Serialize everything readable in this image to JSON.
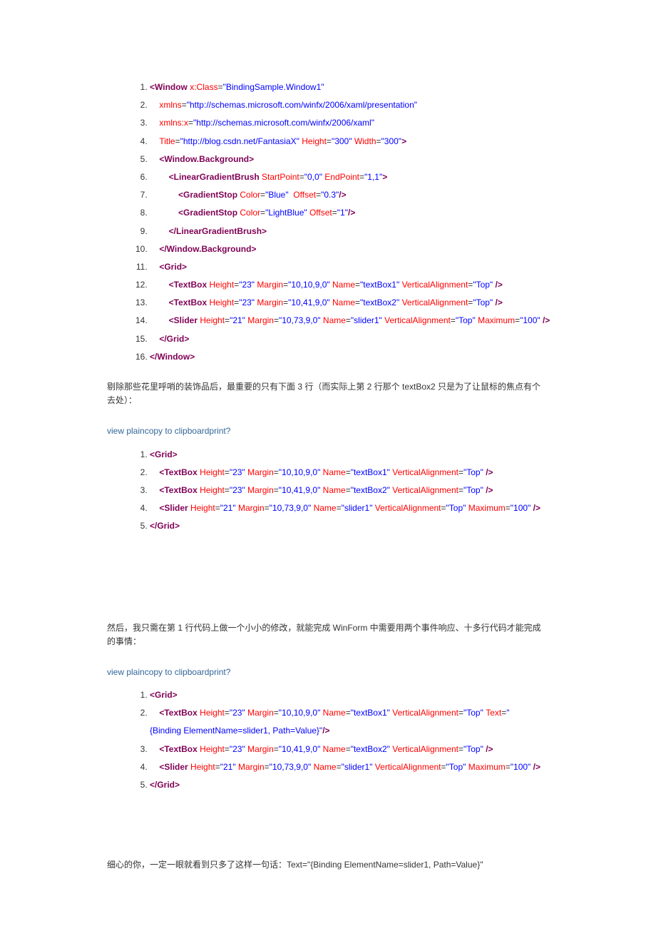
{
  "block1": {
    "lines": [
      [
        {
          "c": "tag",
          "t": "<Window"
        },
        {
          "c": "attr",
          "t": " x:Class"
        },
        {
          "c": "",
          "t": "="
        },
        {
          "c": "val",
          "t": "\"BindingSample.Window1\""
        }
      ],
      [
        {
          "c": "",
          "t": "    "
        },
        {
          "c": "attr",
          "t": "xmlns"
        },
        {
          "c": "",
          "t": "="
        },
        {
          "c": "val",
          "t": "\"http://schemas.microsoft.com/winfx/2006/xaml/presentation\""
        }
      ],
      [
        {
          "c": "",
          "t": "    "
        },
        {
          "c": "attr",
          "t": "xmlns:x"
        },
        {
          "c": "",
          "t": "="
        },
        {
          "c": "val",
          "t": "\"http://schemas.microsoft.com/winfx/2006/xaml\""
        }
      ],
      [
        {
          "c": "",
          "t": "    "
        },
        {
          "c": "attr",
          "t": "Title"
        },
        {
          "c": "",
          "t": "="
        },
        {
          "c": "val",
          "t": "\"http://blog.csdn.net/FantasiaX\""
        },
        {
          "c": "attr",
          "t": " Height"
        },
        {
          "c": "",
          "t": "="
        },
        {
          "c": "val",
          "t": "\"300\""
        },
        {
          "c": "attr",
          "t": " Width"
        },
        {
          "c": "",
          "t": "="
        },
        {
          "c": "val",
          "t": "\"300\""
        },
        {
          "c": "tag",
          "t": ">"
        }
      ],
      [
        {
          "c": "",
          "t": "    "
        },
        {
          "c": "tag",
          "t": "<Window.Background>"
        }
      ],
      [
        {
          "c": "",
          "t": "        "
        },
        {
          "c": "tag",
          "t": "<LinearGradientBrush"
        },
        {
          "c": "attr",
          "t": " StartPoint"
        },
        {
          "c": "",
          "t": "="
        },
        {
          "c": "val",
          "t": "\"0,0\""
        },
        {
          "c": "attr",
          "t": " EndPoint"
        },
        {
          "c": "",
          "t": "="
        },
        {
          "c": "val",
          "t": "\"1,1\""
        },
        {
          "c": "tag",
          "t": ">"
        }
      ],
      [
        {
          "c": "",
          "t": "            "
        },
        {
          "c": "tag",
          "t": "<GradientStop"
        },
        {
          "c": "attr",
          "t": " Color"
        },
        {
          "c": "",
          "t": "="
        },
        {
          "c": "val",
          "t": "\"Blue\""
        },
        {
          "c": "attr",
          "t": "  Offset"
        },
        {
          "c": "",
          "t": "="
        },
        {
          "c": "val",
          "t": "\"0.3\""
        },
        {
          "c": "tag",
          "t": "/>"
        }
      ],
      [
        {
          "c": "",
          "t": "            "
        },
        {
          "c": "tag",
          "t": "<GradientStop"
        },
        {
          "c": "attr",
          "t": " Color"
        },
        {
          "c": "",
          "t": "="
        },
        {
          "c": "val",
          "t": "\"LightBlue\""
        },
        {
          "c": "attr",
          "t": " Offset"
        },
        {
          "c": "",
          "t": "="
        },
        {
          "c": "val",
          "t": "\"1\""
        },
        {
          "c": "tag",
          "t": "/>"
        }
      ],
      [
        {
          "c": "",
          "t": "        "
        },
        {
          "c": "tag",
          "t": "</LinearGradientBrush>"
        }
      ],
      [
        {
          "c": "",
          "t": "    "
        },
        {
          "c": "tag",
          "t": "</Window.Background>"
        }
      ],
      [
        {
          "c": "",
          "t": "    "
        },
        {
          "c": "tag",
          "t": "<Grid>"
        }
      ],
      [
        {
          "c": "",
          "t": "        "
        },
        {
          "c": "tag",
          "t": "<TextBox"
        },
        {
          "c": "attr",
          "t": " Height"
        },
        {
          "c": "",
          "t": "="
        },
        {
          "c": "val",
          "t": "\"23\""
        },
        {
          "c": "attr",
          "t": " Margin"
        },
        {
          "c": "",
          "t": "="
        },
        {
          "c": "val",
          "t": "\"10,10,9,0\""
        },
        {
          "c": "attr",
          "t": " Name"
        },
        {
          "c": "",
          "t": "="
        },
        {
          "c": "val",
          "t": "\"textBox1\""
        },
        {
          "c": "attr",
          "t": " VerticalAlignment"
        },
        {
          "c": "",
          "t": "="
        },
        {
          "c": "val",
          "t": "\"Top\""
        },
        {
          "c": "tag",
          "t": " />"
        }
      ],
      [
        {
          "c": "",
          "t": "        "
        },
        {
          "c": "tag",
          "t": "<TextBox"
        },
        {
          "c": "attr",
          "t": " Height"
        },
        {
          "c": "",
          "t": "="
        },
        {
          "c": "val",
          "t": "\"23\""
        },
        {
          "c": "attr",
          "t": " Margin"
        },
        {
          "c": "",
          "t": "="
        },
        {
          "c": "val",
          "t": "\"10,41,9,0\""
        },
        {
          "c": "attr",
          "t": " Name"
        },
        {
          "c": "",
          "t": "="
        },
        {
          "c": "val",
          "t": "\"textBox2\""
        },
        {
          "c": "attr",
          "t": " VerticalAlignment"
        },
        {
          "c": "",
          "t": "="
        },
        {
          "c": "val",
          "t": "\"Top\""
        },
        {
          "c": "tag",
          "t": " />"
        }
      ],
      [
        {
          "c": "",
          "t": "        "
        },
        {
          "c": "tag",
          "t": "<Slider"
        },
        {
          "c": "attr",
          "t": " Height"
        },
        {
          "c": "",
          "t": "="
        },
        {
          "c": "val",
          "t": "\"21\""
        },
        {
          "c": "attr",
          "t": " Margin"
        },
        {
          "c": "",
          "t": "="
        },
        {
          "c": "val",
          "t": "\"10,73,9,0\""
        },
        {
          "c": "attr",
          "t": " Name"
        },
        {
          "c": "",
          "t": "="
        },
        {
          "c": "val",
          "t": "\"slider1\""
        },
        {
          "c": "attr",
          "t": " VerticalAlignment"
        },
        {
          "c": "",
          "t": "="
        },
        {
          "c": "val",
          "t": "\"Top\""
        },
        {
          "c": "attr",
          "t": " Maximum"
        },
        {
          "c": "",
          "t": "="
        },
        {
          "c": "val",
          "t": "\"100\""
        },
        {
          "c": "tag",
          "t": " />"
        }
      ],
      [
        {
          "c": "",
          "t": "    "
        },
        {
          "c": "tag",
          "t": "</Grid>"
        }
      ],
      [
        {
          "c": "tag",
          "t": "</Window>"
        }
      ]
    ]
  },
  "para1": "剔除那些花里呼哨的装饰品后，最重要的只有下面 3 行（而实际上第 2 行那个 textBox2 只是为了让鼠标的焦点有个去处）：",
  "linkText": "view plaincopy to clipboardprint?",
  "block2": {
    "lines": [
      [
        {
          "c": "tag",
          "t": "<Grid>"
        }
      ],
      [
        {
          "c": "",
          "t": "    "
        },
        {
          "c": "tag",
          "t": "<TextBox"
        },
        {
          "c": "attr",
          "t": " Height"
        },
        {
          "c": "",
          "t": "="
        },
        {
          "c": "val",
          "t": "\"23\""
        },
        {
          "c": "attr",
          "t": " Margin"
        },
        {
          "c": "",
          "t": "="
        },
        {
          "c": "val",
          "t": "\"10,10,9,0\""
        },
        {
          "c": "attr",
          "t": " Name"
        },
        {
          "c": "",
          "t": "="
        },
        {
          "c": "val",
          "t": "\"textBox1\""
        },
        {
          "c": "attr",
          "t": " VerticalAlignment"
        },
        {
          "c": "",
          "t": "="
        },
        {
          "c": "val",
          "t": "\"Top\""
        },
        {
          "c": "tag",
          "t": " />"
        }
      ],
      [
        {
          "c": "",
          "t": "    "
        },
        {
          "c": "tag",
          "t": "<TextBox"
        },
        {
          "c": "attr",
          "t": " Height"
        },
        {
          "c": "",
          "t": "="
        },
        {
          "c": "val",
          "t": "\"23\""
        },
        {
          "c": "attr",
          "t": " Margin"
        },
        {
          "c": "",
          "t": "="
        },
        {
          "c": "val",
          "t": "\"10,41,9,0\""
        },
        {
          "c": "attr",
          "t": " Name"
        },
        {
          "c": "",
          "t": "="
        },
        {
          "c": "val",
          "t": "\"textBox2\""
        },
        {
          "c": "attr",
          "t": " VerticalAlignment"
        },
        {
          "c": "",
          "t": "="
        },
        {
          "c": "val",
          "t": "\"Top\""
        },
        {
          "c": "tag",
          "t": " />"
        }
      ],
      [
        {
          "c": "",
          "t": "    "
        },
        {
          "c": "tag",
          "t": "<Slider"
        },
        {
          "c": "attr",
          "t": " Height"
        },
        {
          "c": "",
          "t": "="
        },
        {
          "c": "val",
          "t": "\"21\""
        },
        {
          "c": "attr",
          "t": " Margin"
        },
        {
          "c": "",
          "t": "="
        },
        {
          "c": "val",
          "t": "\"10,73,9,0\""
        },
        {
          "c": "attr",
          "t": " Name"
        },
        {
          "c": "",
          "t": "="
        },
        {
          "c": "val",
          "t": "\"slider1\""
        },
        {
          "c": "attr",
          "t": " VerticalAlignment"
        },
        {
          "c": "",
          "t": "="
        },
        {
          "c": "val",
          "t": "\"Top\""
        },
        {
          "c": "attr",
          "t": " Maximum"
        },
        {
          "c": "",
          "t": "="
        },
        {
          "c": "val",
          "t": "\"100\""
        },
        {
          "c": "tag",
          "t": " />"
        }
      ],
      [
        {
          "c": "tag",
          "t": "</Grid>"
        }
      ]
    ]
  },
  "para2": "然后，我只需在第 1 行代码上做一个小小的修改，就能完成 WinForm 中需要用两个事件响应、十多行代码才能完成的事情：",
  "block3": {
    "lines": [
      [
        {
          "c": "tag",
          "t": "<Grid>"
        }
      ],
      [
        {
          "c": "",
          "t": "    "
        },
        {
          "c": "tag",
          "t": "<TextBox"
        },
        {
          "c": "attr",
          "t": " Height"
        },
        {
          "c": "",
          "t": "="
        },
        {
          "c": "val",
          "t": "\"23\""
        },
        {
          "c": "attr",
          "t": " Margin"
        },
        {
          "c": "",
          "t": "="
        },
        {
          "c": "val",
          "t": "\"10,10,9,0\""
        },
        {
          "c": "attr",
          "t": " Name"
        },
        {
          "c": "",
          "t": "="
        },
        {
          "c": "val",
          "t": "\"textBox1\""
        },
        {
          "c": "attr",
          "t": " VerticalAlignment"
        },
        {
          "c": "",
          "t": "="
        },
        {
          "c": "val",
          "t": "\"Top\""
        },
        {
          "c": "attr",
          "t": " Text"
        },
        {
          "c": "",
          "t": "="
        },
        {
          "c": "val",
          "t": "\"{Binding ElementName=slider1, Path=Value}\""
        },
        {
          "c": "tag",
          "t": "/>"
        }
      ],
      [
        {
          "c": "",
          "t": "    "
        },
        {
          "c": "tag",
          "t": "<TextBox"
        },
        {
          "c": "attr",
          "t": " Height"
        },
        {
          "c": "",
          "t": "="
        },
        {
          "c": "val",
          "t": "\"23\""
        },
        {
          "c": "attr",
          "t": " Margin"
        },
        {
          "c": "",
          "t": "="
        },
        {
          "c": "val",
          "t": "\"10,41,9,0\""
        },
        {
          "c": "attr",
          "t": " Name"
        },
        {
          "c": "",
          "t": "="
        },
        {
          "c": "val",
          "t": "\"textBox2\""
        },
        {
          "c": "attr",
          "t": " VerticalAlignment"
        },
        {
          "c": "",
          "t": "="
        },
        {
          "c": "val",
          "t": "\"Top\""
        },
        {
          "c": "tag",
          "t": " />"
        }
      ],
      [
        {
          "c": "",
          "t": "    "
        },
        {
          "c": "tag",
          "t": "<Slider"
        },
        {
          "c": "attr",
          "t": " Height"
        },
        {
          "c": "",
          "t": "="
        },
        {
          "c": "val",
          "t": "\"21\""
        },
        {
          "c": "attr",
          "t": " Margin"
        },
        {
          "c": "",
          "t": "="
        },
        {
          "c": "val",
          "t": "\"10,73,9,0\""
        },
        {
          "c": "attr",
          "t": " Name"
        },
        {
          "c": "",
          "t": "="
        },
        {
          "c": "val",
          "t": "\"slider1\""
        },
        {
          "c": "attr",
          "t": " VerticalAlignment"
        },
        {
          "c": "",
          "t": "="
        },
        {
          "c": "val",
          "t": "\"Top\""
        },
        {
          "c": "attr",
          "t": " Maximum"
        },
        {
          "c": "",
          "t": "="
        },
        {
          "c": "val",
          "t": "\"100\""
        },
        {
          "c": "tag",
          "t": " />"
        }
      ],
      [
        {
          "c": "tag",
          "t": "</Grid>"
        }
      ]
    ]
  },
  "para3": "细心的你，一定一眼就看到只多了这样一句话：Text=\"{Binding ElementName=slider1, Path=Value}\""
}
